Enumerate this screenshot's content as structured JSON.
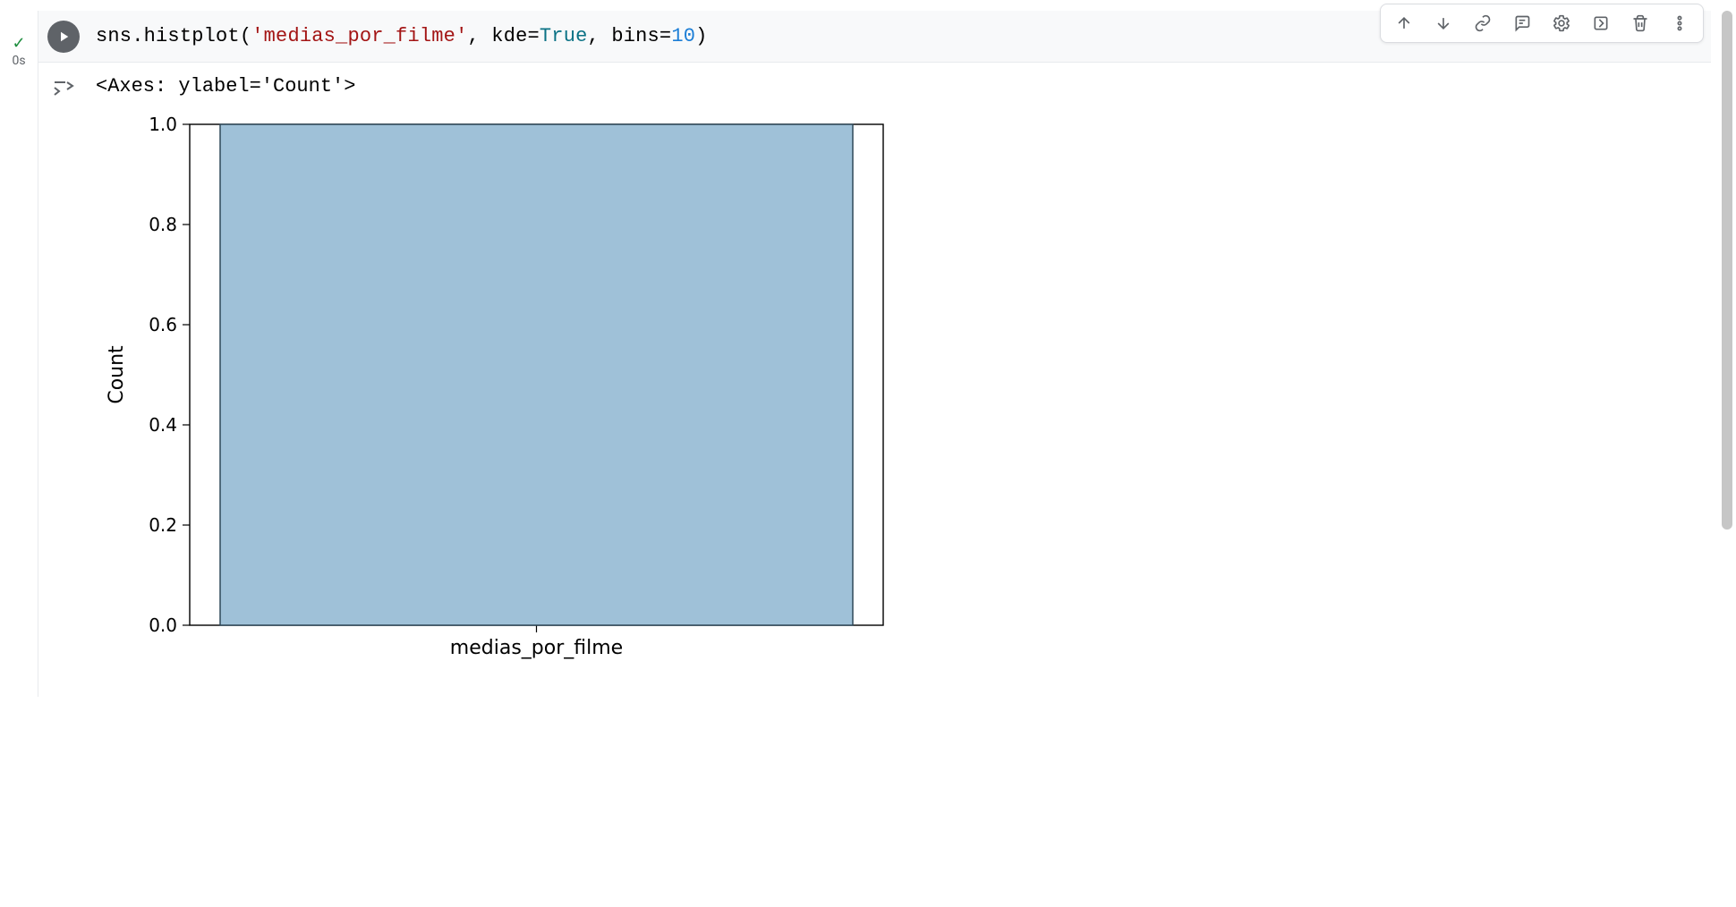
{
  "cell": {
    "status_icon": "check",
    "timing": "0s",
    "code": {
      "fn": "sns.histplot(",
      "arg_str": "'medias_por_filme'",
      "sep1": ", kde=",
      "kw_true": "True",
      "sep2": ", bins=",
      "num_bins": "10",
      "close": ")"
    }
  },
  "output": {
    "repr": "<Axes: ylabel='Count'>"
  },
  "chart_data": {
    "type": "bar",
    "categories": [
      "medias_por_filme"
    ],
    "values": [
      1.0
    ],
    "title": "",
    "xlabel": "medias_por_filme",
    "ylabel": "Count",
    "ylim": [
      0.0,
      1.0
    ],
    "yticks": [
      "0.0",
      "0.2",
      "0.4",
      "0.6",
      "0.8",
      "1.0"
    ],
    "bar_color": "#9fc1d8",
    "bar_edge": "#2f4858"
  },
  "toolbar": {
    "move_up": "Move cell up",
    "move_down": "Move cell down",
    "link": "Link to cell",
    "comment": "Add comment",
    "settings": "Settings",
    "mirror": "Mirror cell",
    "delete": "Delete cell",
    "more": "More actions"
  }
}
